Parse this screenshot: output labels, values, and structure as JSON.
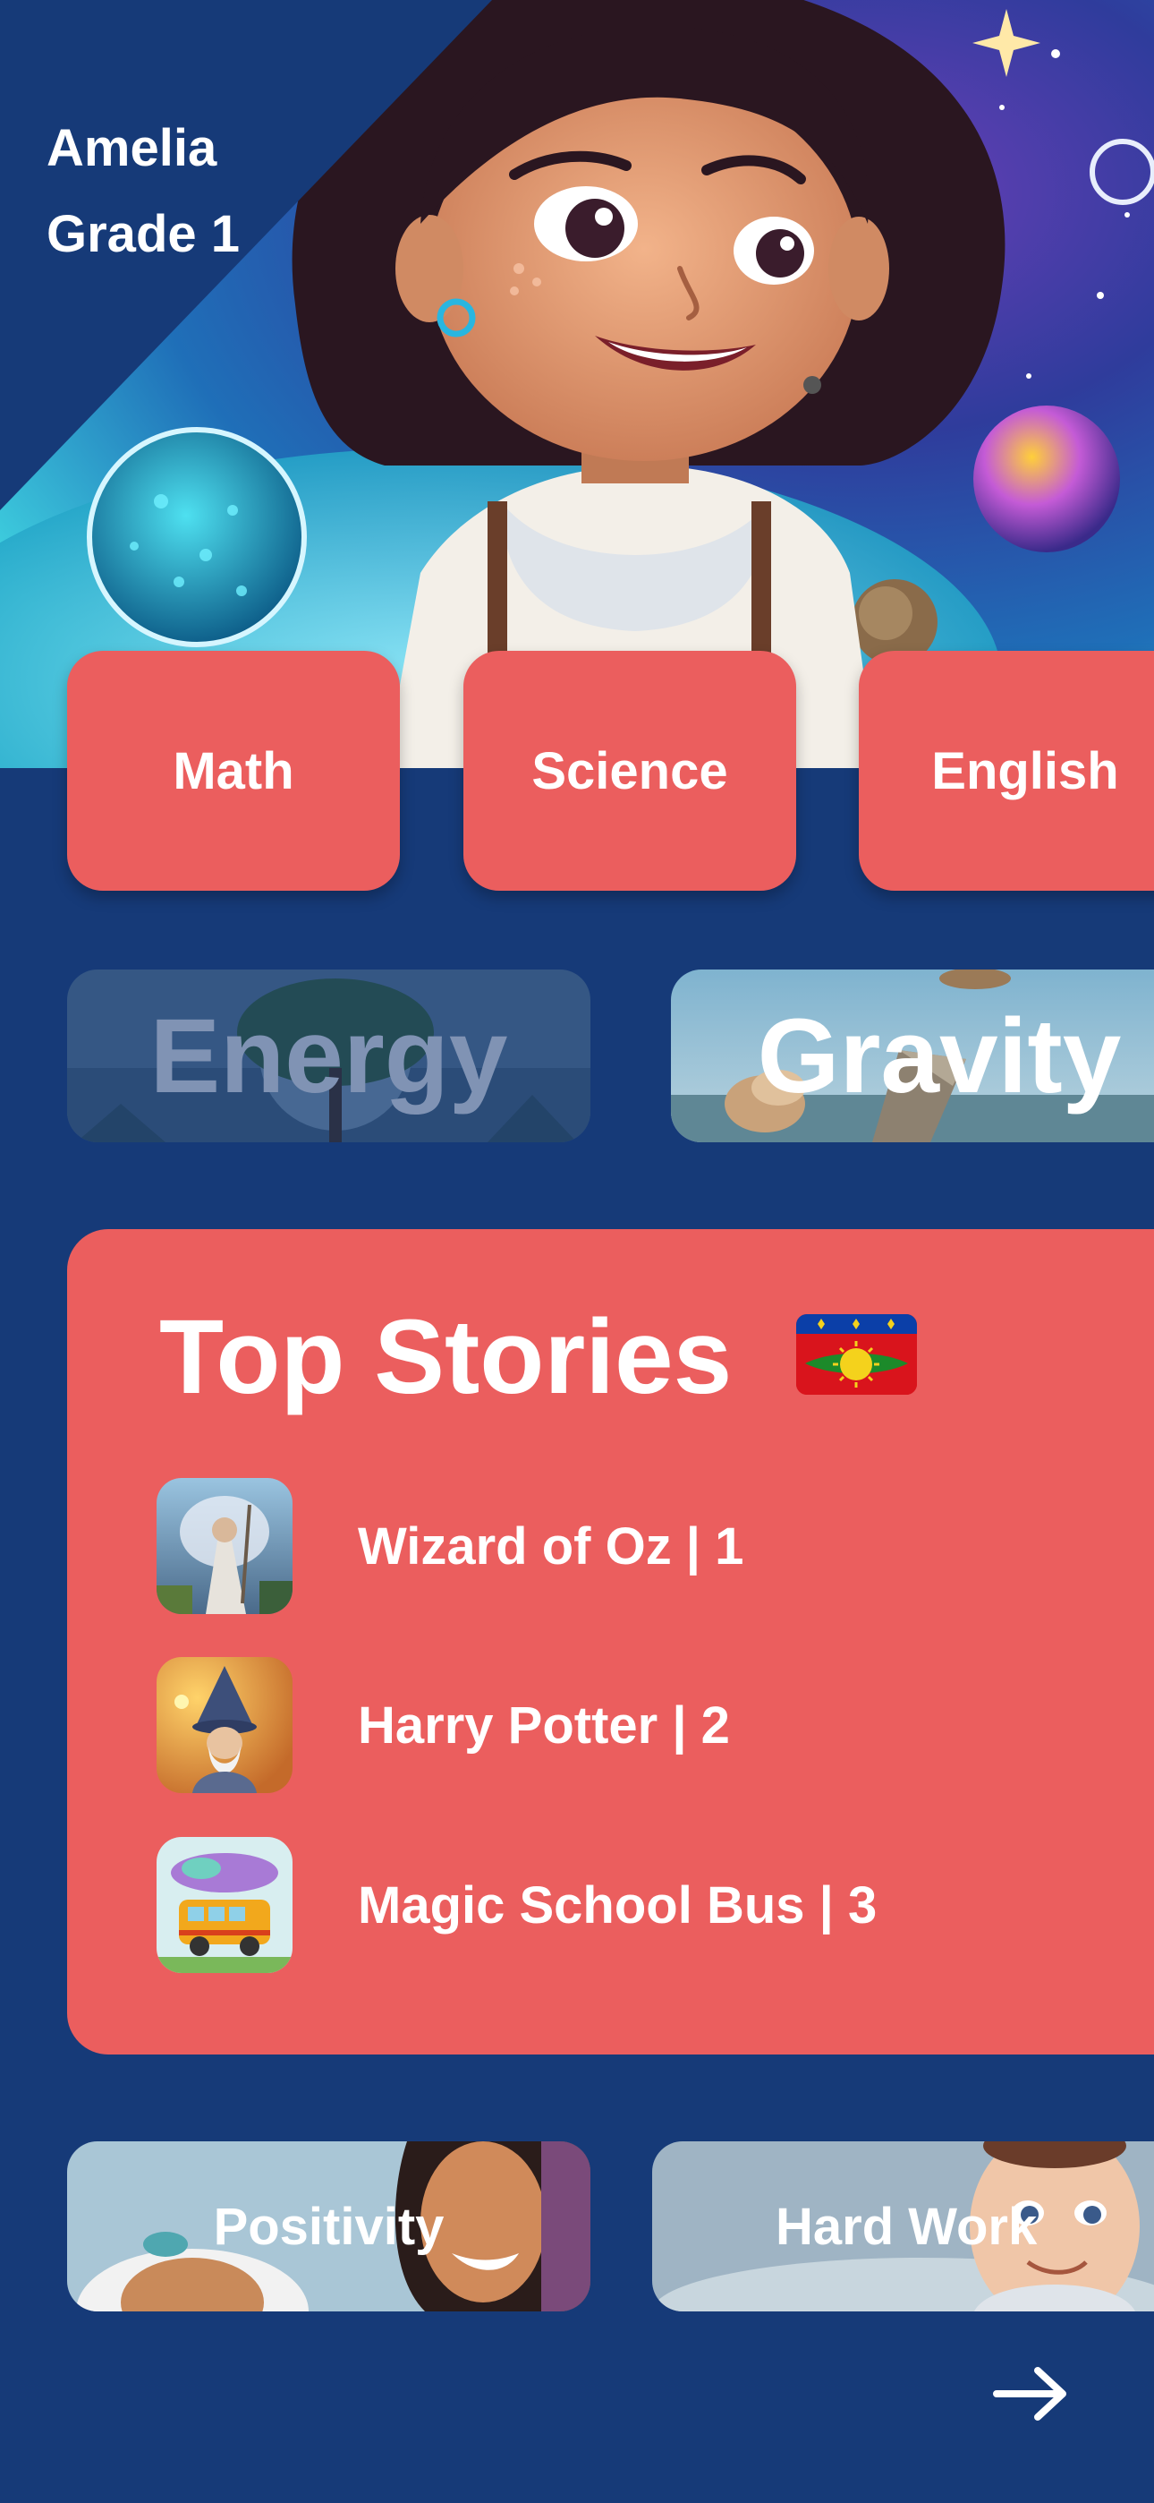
{
  "profile": {
    "name": "Amelia",
    "grade": "Grade 1"
  },
  "subjects": [
    {
      "label": "Math"
    },
    {
      "label": "Science"
    },
    {
      "label": "English"
    }
  ],
  "topics": [
    {
      "label": "Energy",
      "state": "dimmed"
    },
    {
      "label": "Gravity"
    }
  ],
  "top_stories": {
    "title": "Top Stories",
    "flag_icon": "guadeloupe-flag-icon",
    "items": [
      {
        "label": "Wizard of Oz | 1"
      },
      {
        "label": "Harry Potter | 2"
      },
      {
        "label": "Magic School Bus | 3"
      }
    ]
  },
  "values": [
    {
      "label": "Positivity"
    },
    {
      "label": "Hard Work"
    }
  ],
  "navigation": {
    "next_icon": "arrow-right-icon"
  },
  "colors": {
    "background": "#163A78",
    "accent": "#EB5E5E",
    "text": "#FFFFFF"
  }
}
